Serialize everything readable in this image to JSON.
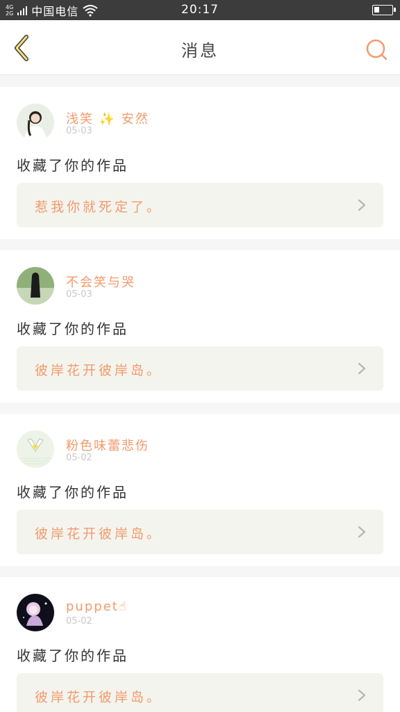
{
  "status_bar": {
    "net_top": "4G",
    "net_bottom": "2G",
    "carrier": "中国电信",
    "time": "20:17",
    "battery_level": 0.3
  },
  "header": {
    "title": "消息",
    "back_icon": "chevron-left-icon",
    "search_icon": "search-icon",
    "accent_color": "#f29a6b"
  },
  "messages": [
    {
      "username": "浅笑 ✨ 安然",
      "date": "05-03",
      "action": "收藏了你的作品",
      "work_title": "惹我你就死定了。"
    },
    {
      "username": "不会笑与哭",
      "date": "05-03",
      "action": "收藏了你的作品",
      "work_title": "彼岸花开彼岸岛。"
    },
    {
      "username": "粉色味蕾悲伤",
      "date": "05-02",
      "action": "收藏了你的作品",
      "work_title": "彼岸花开彼岸岛。"
    },
    {
      "username": "puppet☝",
      "date": "05-02",
      "action": "收藏了你的作品",
      "work_title": "彼岸花开彼岸岛。"
    }
  ]
}
